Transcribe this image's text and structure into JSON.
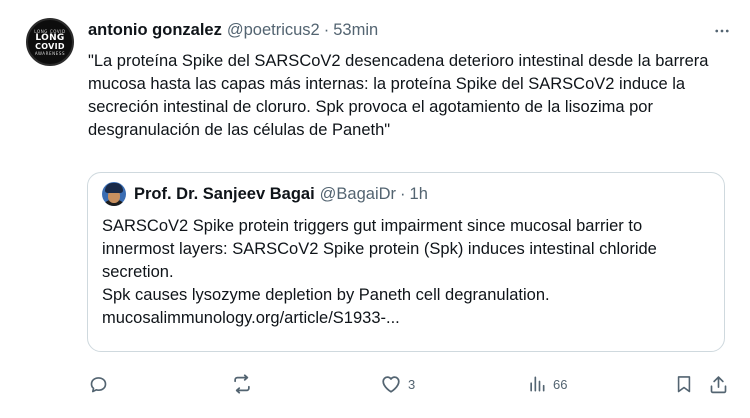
{
  "author": {
    "display_name": "antonio gonzalez",
    "handle": "@poetricus2",
    "separator": "·",
    "time": "53min",
    "avatar": {
      "ring_top": "LONG COVID",
      "word1": "LONG",
      "word2": "COVID",
      "ring_bottom": "AWARENESS"
    }
  },
  "tweet_text": "\"La proteína Spike del SARSCoV2 desencadena deterioro intestinal desde la barrera mucosa hasta las capas más internas: la proteína Spike del SARSCoV2 induce la secreción intestinal de cloruro. Spk provoca el agotamiento de la lisozima por desgranulación de las células de Paneth\"",
  "quoted": {
    "display_name": "Prof. Dr. Sanjeev Bagai",
    "handle": "@BagaiDr",
    "separator": "·",
    "time": "1h",
    "lines": [
      "SARSCoV2 Spike protein triggers gut impairment since mucosal barrier to",
      "innermost layers: SARSCoV2 Spike protein (Spk) induces intestinal chloride",
      "secretion.",
      "Spk causes lysozyme depletion by Paneth cell degranulation.",
      "mucosalimmunology.org/article/S1933-..."
    ]
  },
  "actions": {
    "reply_count": "",
    "repost_count": "",
    "like_count": "3",
    "views_count": "66"
  },
  "icons": {
    "more": "more-icon",
    "reply": "reply-icon",
    "repost": "repost-icon",
    "like": "heart-icon",
    "views": "views-icon",
    "bookmark": "bookmark-icon",
    "share": "share-icon"
  },
  "colors": {
    "text": "#0f1419",
    "secondary": "#536471",
    "border": "#cfd9de"
  }
}
